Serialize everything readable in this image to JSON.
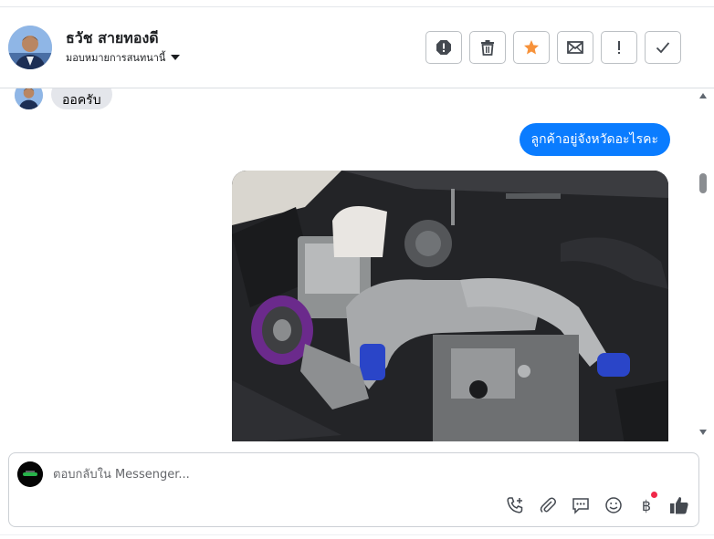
{
  "header": {
    "contact_name": "ธวัช สายทองดี",
    "assign_label": "มอบหมายการสนทนานี้",
    "actions": [
      {
        "name": "spam-button",
        "icon": "alert-octagon-icon"
      },
      {
        "name": "delete-button",
        "icon": "trash-icon"
      },
      {
        "name": "star-button",
        "icon": "star-icon",
        "color": "#f7923a"
      },
      {
        "name": "mark-unread-button",
        "icon": "envelope-icon"
      },
      {
        "name": "follow-up-button",
        "icon": "exclamation-icon"
      },
      {
        "name": "mark-done-button",
        "icon": "check-icon"
      }
    ]
  },
  "thread": {
    "incoming_text": "ออครับ",
    "outgoing_text": "ลูกค้าอยู่จังหวัดอะไรคะ",
    "outgoing_color": "#0a7cff",
    "photo_subject": "engine-bay-photo"
  },
  "composer": {
    "placeholder": "ตอบกลับใน Messenger...",
    "value": "",
    "tools": [
      "add-call-icon",
      "paperclip-icon",
      "saved-reply-icon",
      "emoji-icon",
      "baht-payment-icon",
      "thumbs-up-icon"
    ],
    "baht_symbol": "฿",
    "notification_color": "#f02849"
  }
}
